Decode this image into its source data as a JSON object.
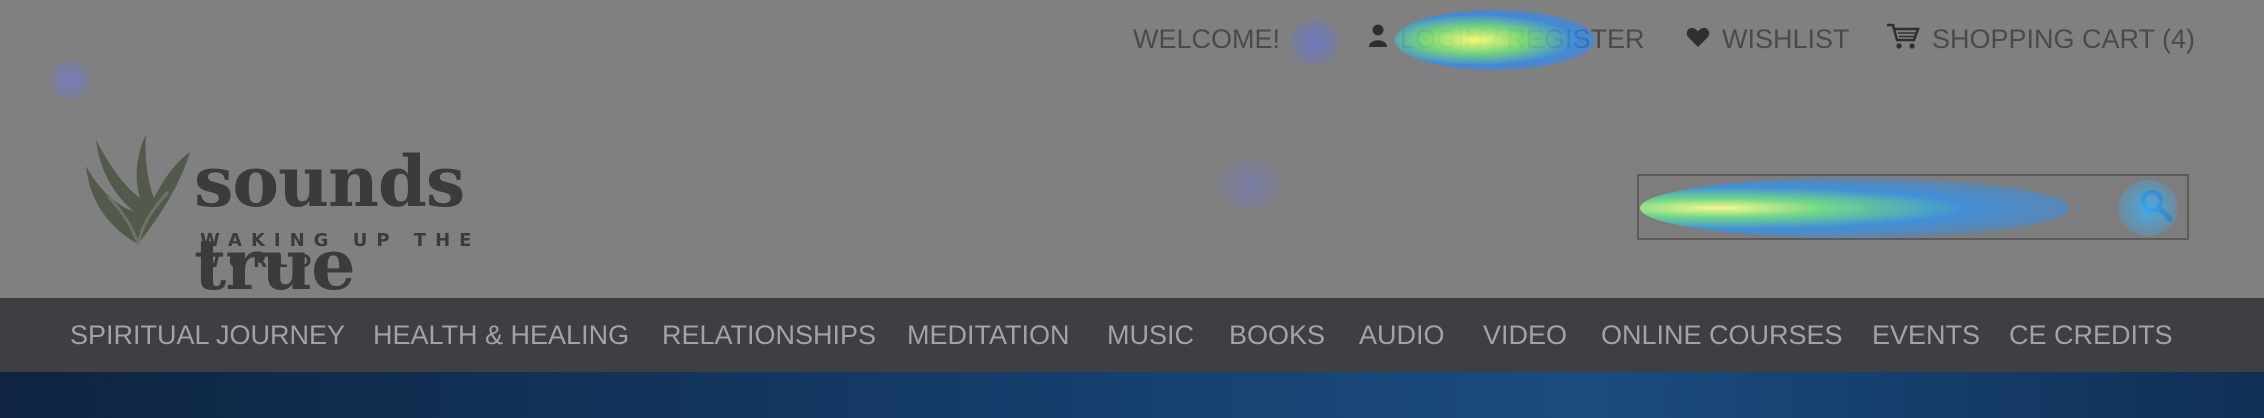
{
  "topbar": {
    "welcome": "WELCOME!",
    "login": "LOGIN / REGISTER",
    "wishlist": "WISHLIST",
    "cart": "SHOPPING CART (4)"
  },
  "logo": {
    "name": "sounds true",
    "tagline": "WAKING UP THE WORLD"
  },
  "search": {
    "placeholder": "··············"
  },
  "nav": {
    "items": [
      "SPIRITUAL JOURNEY",
      "HEALTH & HEALING",
      "RELATIONSHIPS",
      "MEDITATION",
      "MUSIC",
      "BOOKS",
      "AUDIO",
      "VIDEO",
      "ONLINE COURSES",
      "EVENTS",
      "CE CREDITS"
    ]
  },
  "icons": {
    "user": "user-icon",
    "heart": "heart-icon",
    "cart": "cart-icon",
    "search": "search-icon",
    "logo": "wings-logo-icon"
  },
  "colors": {
    "nav_bg": "#3d3f42",
    "page_bg": "#808080",
    "hero_bg": "#143a66"
  }
}
